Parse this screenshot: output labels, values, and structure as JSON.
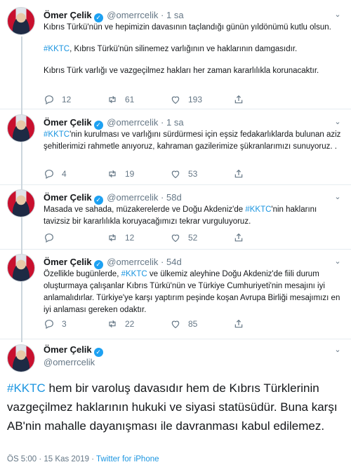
{
  "tweets": [
    {
      "name": "Ömer Çelik",
      "handle": "@omerrcelik",
      "sep": "·",
      "time": "1 sa",
      "paragraphs": [
        [
          {
            "t": "Kıbrıs Türkü'nün ve hepimizin davasının taçlandığı günün yıldönümü kutlu olsun."
          }
        ],
        [
          {
            "t": "#KKTC",
            "tag": true
          },
          {
            "t": ", Kıbrıs Türkü'nün silinemez varlığının ve haklarının damgasıdır."
          }
        ],
        [
          {
            "t": "Kıbrıs Türk varlığı ve vazgeçilmez hakları her zaman kararlılıkla korunacaktır."
          }
        ]
      ],
      "replies": "12",
      "retweets": "61",
      "likes": "193"
    },
    {
      "name": "Ömer Çelik",
      "handle": "@omerrcelik",
      "sep": "·",
      "time": "1 sa",
      "paragraphs": [
        [
          {
            "t": "#KKTC",
            "tag": true
          },
          {
            "t": "'nin kurulması ve varlığını sürdürmesi için eşsiz fedakarlıklarda bulunan aziz şehitlerimizi rahmetle anıyoruz, kahraman gazilerimize şükranlarımızı sunuyoruz. ."
          }
        ]
      ],
      "replies": "4",
      "retweets": "19",
      "likes": "53"
    },
    {
      "name": "Ömer Çelik",
      "handle": "@omerrcelik",
      "sep": "·",
      "time": "58d",
      "paragraphs": [
        [
          {
            "t": "Masada ve sahada, müzakerelerde ve Doğu Akdeniz'de "
          },
          {
            "t": "#KKTC",
            "tag": true
          },
          {
            "t": "'nin  haklarını tavizsiz bir kararlılıkla koruyacağımızı tekrar vurguluyoruz."
          }
        ]
      ],
      "replies": "",
      "retweets": "12",
      "likes": "52"
    },
    {
      "name": "Ömer Çelik",
      "handle": "@omerrcelik",
      "sep": "·",
      "time": "54d",
      "paragraphs": [
        [
          {
            "t": "Özellikle bugünlerde, "
          },
          {
            "t": "#KKTC",
            "tag": true
          },
          {
            "t": " ve ülkemiz aleyhine Doğu Akdeniz'de fiili durum oluşturmaya çalışanlar Kıbrıs Türkü'nün ve Türkiye Cumhuriyeti'nin mesajını iyi anlamalıdırlar. Türkiye'ye karşı yaptırım peşinde koşan Avrupa Birliği mesajımızı en iyi anlaması gereken odaktır."
          }
        ]
      ],
      "replies": "3",
      "retweets": "22",
      "likes": "85"
    }
  ],
  "main": {
    "name": "Ömer Çelik",
    "handle": "@omerrcelik",
    "tag": "#KKTC",
    "text": " hem bir varoluş davasıdır hem de Kıbrıs Türklerinin vazgeçilmez haklarının hukuki ve siyasi statüsüdür. Buna karşı AB'nin mahalle dayanışması ile davranması kabul edilemez.",
    "time": "ÖS 5:00 · 15 Kas 2019 · ",
    "source": "Twitter for iPhone"
  },
  "icons": {
    "verified": "✓",
    "caret": "⌄"
  },
  "colors": {
    "accent": "#1da1f2",
    "link": "#1b95e0",
    "muted": "#657786"
  }
}
